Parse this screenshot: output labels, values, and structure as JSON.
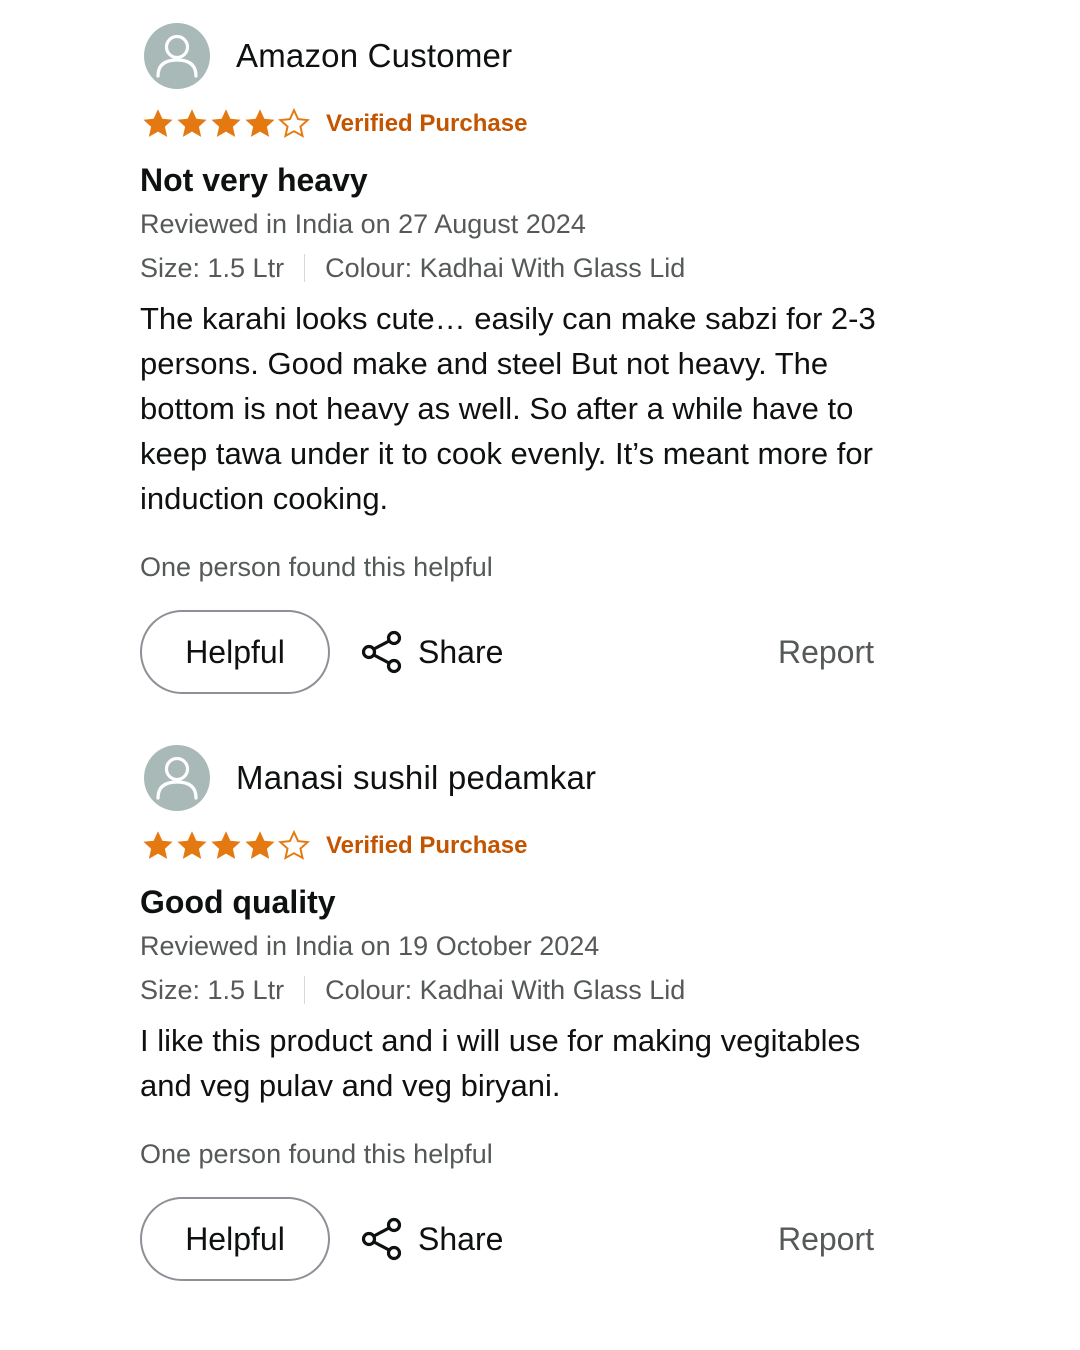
{
  "reviews": [
    {
      "reviewer_name": "Amazon Customer",
      "rating": 4,
      "rating_max": 5,
      "verified_label": "Verified Purchase",
      "title": "Not very heavy",
      "review_date": "Reviewed in India on 27 August 2024",
      "size": "Size: 1.5 Ltr",
      "colour": "Colour: Kadhai With Glass Lid",
      "body": "The karahi looks cute… easily can make sabzi for 2-3 persons. Good make and steel But not heavy. The bottom is not heavy as well. So after a while have to keep tawa under it to cook evenly. It’s meant more for induction cooking.",
      "helpful_count_text": "One person found this helpful",
      "helpful_button": "Helpful",
      "share_label": "Share",
      "report_label": "Report"
    },
    {
      "reviewer_name": "Manasi sushil pedamkar",
      "rating": 4,
      "rating_max": 5,
      "verified_label": "Verified Purchase",
      "title": "Good quality",
      "review_date": "Reviewed in India on 19 October 2024",
      "size": "Size: 1.5 Ltr",
      "colour": "Colour: Kadhai With Glass Lid",
      "body": "I like this product and i will use for making vegitables and veg pulav and veg biryani.",
      "helpful_count_text": "One person found this helpful",
      "helpful_button": "Helpful",
      "share_label": "Share",
      "report_label": "Report"
    }
  ],
  "colors": {
    "star_fill": "#e47911",
    "verified": "#c45500",
    "avatar_bg": "#a9b9b8"
  },
  "icons": {
    "avatar": "user-avatar-icon",
    "star": "star-icon",
    "share": "share-icon"
  }
}
